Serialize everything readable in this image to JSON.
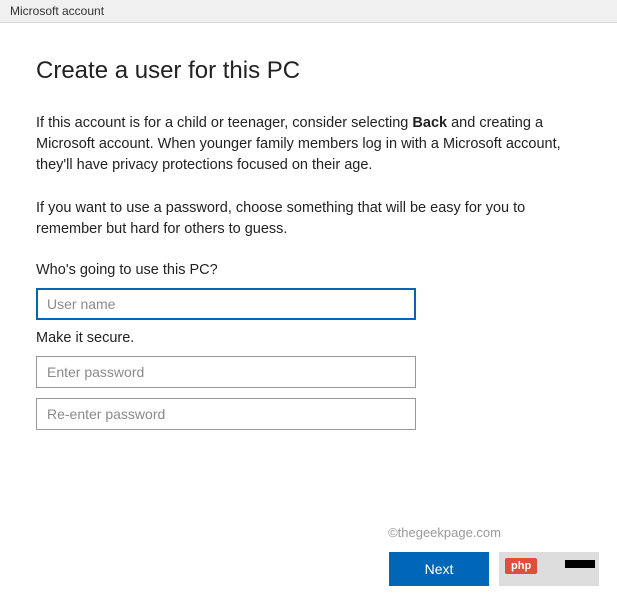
{
  "titlebar": {
    "title": "Microsoft account"
  },
  "heading": "Create a user for this PC",
  "para1_pre": "If this account is for a child or teenager, consider selecting ",
  "para1_bold": "Back",
  "para1_post": " and creating a Microsoft account. When younger family members log in with a Microsoft account, they'll have privacy protections focused on their age.",
  "para2": "If you want to use a password, choose something that will be easy for you to remember but hard for others to guess.",
  "section1_label": "Who's going to use this PC?",
  "username": {
    "placeholder": "User name",
    "value": ""
  },
  "section2_label": "Make it secure.",
  "password": {
    "placeholder": "Enter password",
    "value": ""
  },
  "password2": {
    "placeholder": "Re-enter password",
    "value": ""
  },
  "watermark": "©thegeekpage.com",
  "buttons": {
    "next": "Next",
    "badge": "php"
  }
}
